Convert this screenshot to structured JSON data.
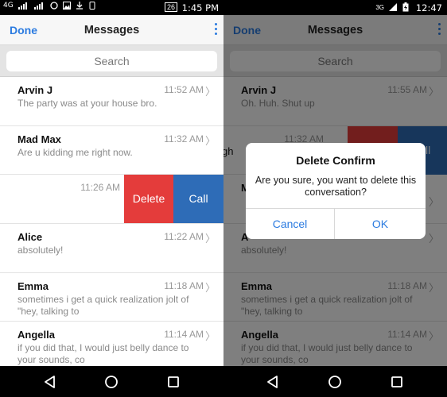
{
  "left_phone": {
    "status_bar": {
      "left_icons": [
        "4G",
        "signal-icon",
        "signal-icon",
        "whatsapp-icon",
        "image-icon",
        "download-icon",
        "phone-icon"
      ],
      "battery": "26",
      "time": "1:45 PM"
    },
    "navbar": {
      "done_label": "Done",
      "title": "Messages"
    },
    "search": {
      "placeholder": "Search"
    },
    "messages": [
      {
        "name": "Arvin J",
        "time": "11:52 AM",
        "preview": "The party was at your house bro."
      },
      {
        "name": "Mad Max",
        "time": "11:32 AM",
        "preview": "Are u kidding me right now."
      },
      {
        "name": "",
        "time": "11:26 AM",
        "preview": ""
      },
      {
        "name": "Alice",
        "time": "11:22 AM",
        "preview": "absolutely!"
      },
      {
        "name": "Emma",
        "time": "11:18 AM",
        "preview": "sometimes i get a quick realization jolt of \"hey, talking to"
      },
      {
        "name": "Angella",
        "time": "11:14 AM",
        "preview": "if you did that, I would just belly dance to your sounds, co"
      }
    ],
    "swipe_actions": {
      "delete_label": "Delete",
      "call_label": "Call"
    }
  },
  "right_phone": {
    "status_bar": {
      "network": "3G",
      "time": "12:47"
    },
    "navbar": {
      "done_label": "Done",
      "title": "Messages"
    },
    "search": {
      "placeholder": "Search"
    },
    "messages": [
      {
        "name": "Arvin J",
        "time": "11:55 AM",
        "preview": "Oh. Huh. Shut up"
      },
      {
        "name": "",
        "time": "11:32 AM",
        "preview": "",
        "partial": "gh"
      },
      {
        "name": "M",
        "time": "",
        "preview": ""
      },
      {
        "name": "A",
        "time": "",
        "preview": "absolutely!"
      },
      {
        "name": "Emma",
        "time": "11:18 AM",
        "preview": "sometimes i get a quick realization jolt of \"hey, talking to"
      },
      {
        "name": "Angella",
        "time": "11:14 AM",
        "preview": "if you did that, I would just belly dance to your sounds, co"
      }
    ],
    "swipe_actions": {
      "call_partial": "ll"
    },
    "dialog": {
      "title": "Delete Confirm",
      "message": "Are you sure, you want to delete this conversation?",
      "cancel_label": "Cancel",
      "ok_label": "OK"
    }
  },
  "colors": {
    "accent": "#2b7be0",
    "delete": "#e43c3b",
    "call": "#2e6cb7"
  }
}
